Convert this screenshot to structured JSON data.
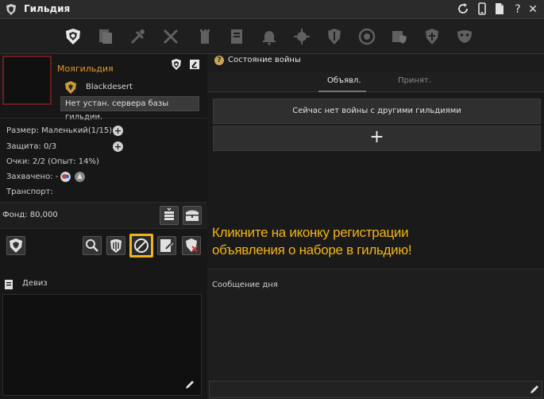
{
  "window": {
    "title": "Гильдия",
    "buttons": [
      "refresh-icon",
      "phone-icon",
      "document-icon",
      "help-icon",
      "close-icon"
    ],
    "help_label": "?",
    "close_label": "✕"
  },
  "tabs": [
    "guild-main-icon",
    "members-icon",
    "skills-icon",
    "crafting-icon",
    "tower-icon",
    "quest-scroll-icon",
    "bell-icon",
    "battle-icon",
    "shield-icon",
    "laurel-icon",
    "house-shield-icon",
    "cross-shield-icon",
    "mask-icon"
  ],
  "guild": {
    "name": "Моягильдия",
    "master": "Blackdesert",
    "server_notice": "Нет устан. сервера базы гильдии."
  },
  "stats": {
    "size": "Размер: Маленький(1/15)",
    "protection": "Защита: 0/3",
    "points": "Очки: 2/2 (Опыт: 14%)",
    "captured": "Захвачено: -",
    "transport": "Транспорт:"
  },
  "funds": {
    "label": "Фонд: 80,000"
  },
  "actions": {
    "left": [
      "guild-emblem-icon"
    ],
    "right": [
      "search-recruit-icon",
      "crest-icon",
      "recruit-ad-icon",
      "edit-notice-icon",
      "disband-icon"
    ],
    "highlighted": "recruit-ad-icon"
  },
  "motto": {
    "label": "Девиз"
  },
  "war": {
    "help": "?",
    "title": "Состояние войны",
    "tabs": [
      {
        "label": "Объявл.",
        "active": true
      },
      {
        "label": "Принят.",
        "active": false
      }
    ],
    "empty_message": "Сейчас нет войны с другими гильдиями",
    "add_label": "+"
  },
  "callout": {
    "line1": "Кликните на иконку регистрации",
    "line2": "объявления о наборе в гильдию!"
  },
  "motd": {
    "label": "Сообщение дня"
  },
  "colors": {
    "accent": "#f2b418",
    "guild_name": "#e8962c",
    "emblem_border": "#6a1d1a"
  }
}
